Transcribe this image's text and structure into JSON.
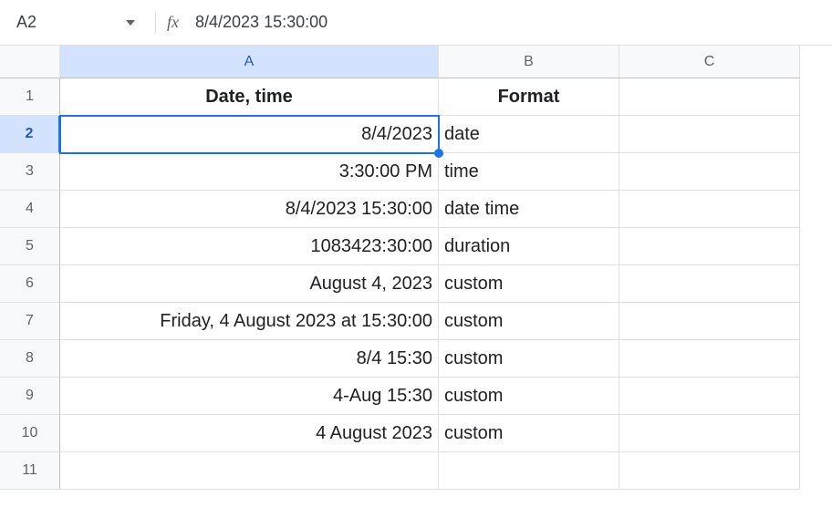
{
  "nameBox": "A2",
  "fxLabel": "fx",
  "formulaValue": "8/4/2023 15:30:00",
  "columns": [
    "A",
    "B",
    "C"
  ],
  "rowNumbers": [
    "1",
    "2",
    "3",
    "4",
    "5",
    "6",
    "7",
    "8",
    "9",
    "10",
    "11"
  ],
  "selectedCell": "A2",
  "selectedRow": 2,
  "selectedCol": "A",
  "header": {
    "colA": "Date, time",
    "colB": "Format"
  },
  "rows": [
    {
      "a": "8/4/2023",
      "b": "date"
    },
    {
      "a": "3:30:00 PM",
      "b": "time"
    },
    {
      "a": "8/4/2023 15:30:00",
      "b": "date time"
    },
    {
      "a": "1083423:30:00",
      "b": "duration"
    },
    {
      "a": "August 4, 2023",
      "b": "custom"
    },
    {
      "a": "Friday, 4 August 2023 at 15:30:00",
      "b": "custom"
    },
    {
      "a": "8/4 15:30",
      "b": "custom"
    },
    {
      "a": "4-Aug 15:30",
      "b": "custom"
    },
    {
      "a": "4 August 2023",
      "b": "custom"
    }
  ]
}
